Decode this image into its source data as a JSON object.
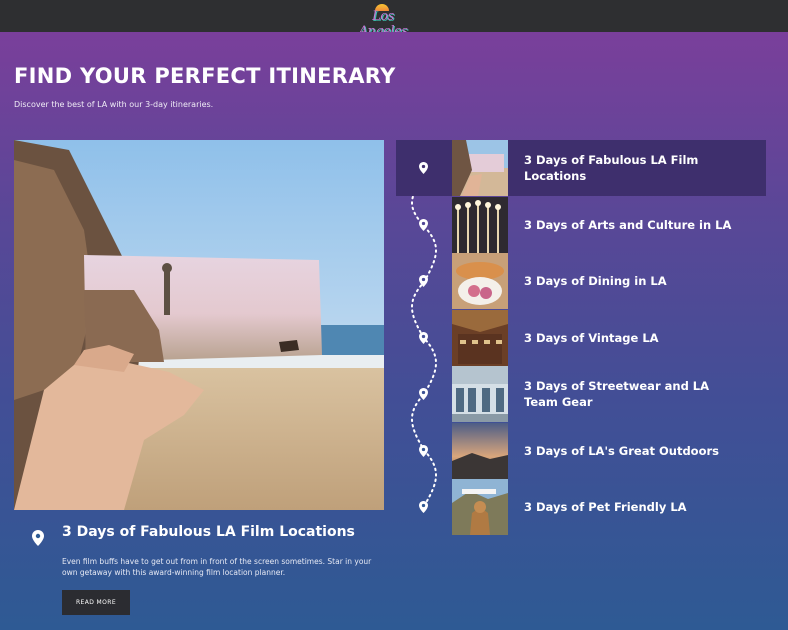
{
  "header": {
    "logo_text": "Los Angeles"
  },
  "hero": {
    "title": "FIND YOUR PERFECT ITINERARY",
    "subtitle": "Discover the best of LA with our 3-day itineraries."
  },
  "featured": {
    "title": "3 Days of Fabulous LA Film Locations",
    "description": "Even film buffs have to get out from in front of the screen sometimes. Star in your own getaway with this award-winning film location planner.",
    "button_label": "READ MORE",
    "image_icon": "beach-photo-with-movie-still"
  },
  "itineraries": [
    {
      "label": "3 Days of Fabulous LA Film Locations",
      "active": true,
      "icon": "map-pin-icon"
    },
    {
      "label": "3 Days of Arts and Culture in LA",
      "active": false,
      "icon": "map-pin-icon"
    },
    {
      "label": "3 Days of Dining in LA",
      "active": false,
      "icon": "map-pin-icon"
    },
    {
      "label": "3 Days of Vintage LA",
      "active": false,
      "icon": "map-pin-icon"
    },
    {
      "label": "3 Days of Streetwear and LA Team Gear",
      "active": false,
      "icon": "map-pin-icon"
    },
    {
      "label": "3 Days of LA's Great Outdoors",
      "active": false,
      "icon": "map-pin-icon"
    },
    {
      "label": "3 Days of Pet Friendly LA",
      "active": false,
      "icon": "map-pin-icon"
    }
  ],
  "colors": {
    "active_item": "#3e2f6d",
    "button": "#2b2c31",
    "topbar": "#2e2f31"
  }
}
